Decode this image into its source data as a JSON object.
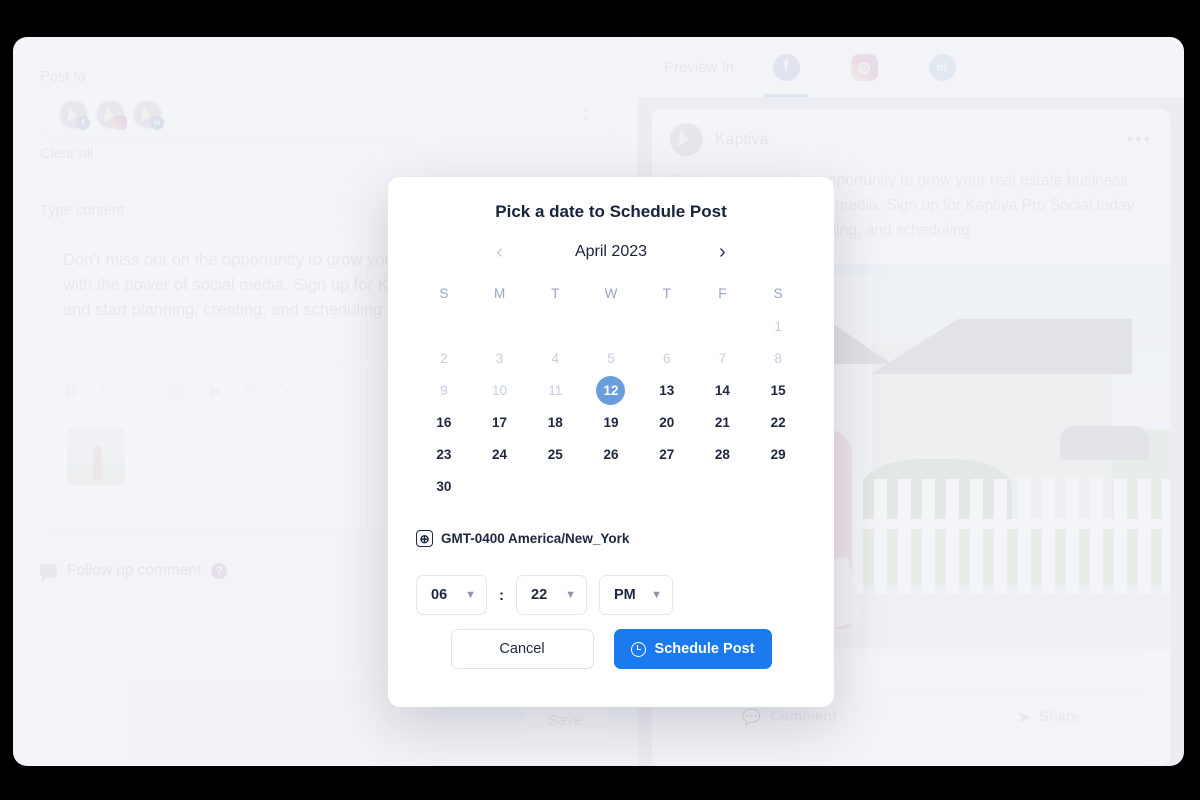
{
  "composer": {
    "post_to_label": "Post to",
    "accounts": [
      {
        "name": "kaptiva-facebook-account",
        "network": "facebook",
        "badge": "f"
      },
      {
        "name": "kaptiva-instagram-account",
        "network": "instagram",
        "badge": "□"
      },
      {
        "name": "kaptiva-linkedin-account",
        "network": "linkedin",
        "badge": "in"
      }
    ],
    "clear_all_label": "Clear all",
    "type_content_label": "Type content",
    "content_text": "Don't miss out on the opportunity to grow your real estate business with the power of social media. Sign up for Kaptiva Pro Social today and start planning, creating, and scheduling",
    "toolbar": [
      {
        "name": "bold-icon",
        "glyph": "B"
      },
      {
        "name": "italic-icon",
        "glyph": "I"
      },
      {
        "name": "emoji-icon",
        "glyph": "☺"
      },
      {
        "name": "image-icon",
        "glyph": "Ὓc"
      },
      {
        "name": "video-icon",
        "glyph": "▶"
      },
      {
        "name": "hashtag-icon",
        "glyph": "#"
      },
      {
        "name": "tag-icon",
        "glyph": "◇"
      }
    ],
    "followup_label": "Follow up comment",
    "followup_help": "?",
    "save_label": "Save"
  },
  "preview": {
    "preview_in_label": "Preview In",
    "tabs": [
      {
        "name": "tab-facebook",
        "network": "facebook",
        "glyph": "f",
        "active": true
      },
      {
        "name": "tab-instagram",
        "network": "instagram",
        "glyph": "◎",
        "active": false
      },
      {
        "name": "tab-linkedin",
        "network": "linkedin",
        "glyph": "in",
        "active": false
      }
    ],
    "author": "Kaptiva",
    "menu": "•••",
    "post_text": "Don't miss out on the opportunity to grow your real estate business with the power of social media. Sign up for Kaptiva Pro Social today and start planning, creating, and scheduling",
    "actions": [
      {
        "name": "comment-action",
        "icon": "comment-icon",
        "label": "Comment"
      },
      {
        "name": "share-action",
        "icon": "share-icon",
        "label": "Share"
      }
    ]
  },
  "modal": {
    "title": "Pick a date to Schedule Post",
    "prev_label": "‹",
    "next_label": "›",
    "month": "April 2023",
    "weekdays": [
      "S",
      "M",
      "T",
      "W",
      "T",
      "F",
      "S"
    ],
    "days": [
      {
        "label": "",
        "state": "empty"
      },
      {
        "label": "",
        "state": "empty"
      },
      {
        "label": "",
        "state": "empty"
      },
      {
        "label": "",
        "state": "empty"
      },
      {
        "label": "",
        "state": "empty"
      },
      {
        "label": "",
        "state": "empty"
      },
      {
        "label": "1",
        "state": "muted"
      },
      {
        "label": "2",
        "state": "muted"
      },
      {
        "label": "3",
        "state": "muted"
      },
      {
        "label": "4",
        "state": "muted"
      },
      {
        "label": "5",
        "state": "muted"
      },
      {
        "label": "6",
        "state": "muted"
      },
      {
        "label": "7",
        "state": "muted"
      },
      {
        "label": "8",
        "state": "muted"
      },
      {
        "label": "9",
        "state": "muted"
      },
      {
        "label": "10",
        "state": "muted"
      },
      {
        "label": "11",
        "state": "muted"
      },
      {
        "label": "12",
        "state": "selected"
      },
      {
        "label": "13",
        "state": "normal"
      },
      {
        "label": "14",
        "state": "normal"
      },
      {
        "label": "15",
        "state": "normal"
      },
      {
        "label": "16",
        "state": "normal"
      },
      {
        "label": "17",
        "state": "normal"
      },
      {
        "label": "18",
        "state": "normal"
      },
      {
        "label": "19",
        "state": "normal"
      },
      {
        "label": "20",
        "state": "normal"
      },
      {
        "label": "21",
        "state": "normal"
      },
      {
        "label": "22",
        "state": "normal"
      },
      {
        "label": "23",
        "state": "normal"
      },
      {
        "label": "24",
        "state": "normal"
      },
      {
        "label": "25",
        "state": "normal"
      },
      {
        "label": "26",
        "state": "normal"
      },
      {
        "label": "27",
        "state": "normal"
      },
      {
        "label": "28",
        "state": "normal"
      },
      {
        "label": "29",
        "state": "normal"
      },
      {
        "label": "30",
        "state": "normal"
      }
    ],
    "selected_date": "12",
    "timezone": "GMT-0400 America/New_York",
    "timezone_icon": "⊕",
    "hour": "06",
    "minute": "22",
    "meridiem": "PM",
    "colon": ":",
    "chevron": "⌄",
    "cancel_label": "Cancel",
    "schedule_label": "Schedule Post"
  },
  "colors": {
    "accent_blue": "#1a7aee",
    "selected_day_blue": "#6a9edb",
    "page_bg": "#f3f4f8",
    "modal_bg": "#ffffff"
  }
}
